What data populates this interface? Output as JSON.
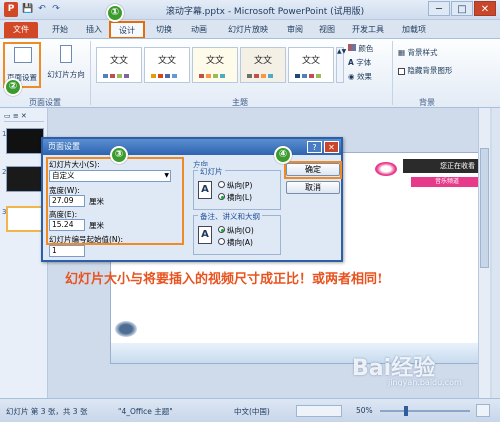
{
  "titlebar": {
    "title": "滚动字幕.pptx - Microsoft PowerPoint (试用版)",
    "logo_letter": "P",
    "qa_save": "💾",
    "qa_undo": "↶",
    "qa_redo": "↷",
    "min": "─",
    "max": "□",
    "close": "✕"
  },
  "tabs": [
    "文件",
    "开始",
    "插入",
    "设计",
    "切换",
    "动画",
    "幻灯片放映",
    "审阅",
    "视图",
    "开发工具",
    "加载项"
  ],
  "ribbon": {
    "page_setup": "页面设置",
    "orientation": "幻灯片方向",
    "group_page_setup": "页面设置",
    "group_themes": "主题",
    "group_background": "背景",
    "theme_text": "文文",
    "colors": "颜色",
    "fonts": "字体",
    "effects": "效果",
    "bg_styles": "背景样式",
    "hide_bg": "隐藏背景图形"
  },
  "slides": {
    "nums": [
      "1",
      "2",
      "3"
    ]
  },
  "dialog": {
    "title": "页面设置",
    "size_label": "幻灯片大小(S):",
    "size_value": "自定义",
    "width_label": "宽度(W):",
    "width_value": "27.09",
    "height_label": "高度(E):",
    "height_value": "15.24",
    "unit": "厘米",
    "start_label": "幻灯片编号起始值(N):",
    "start_value": "1",
    "orientation_label": "方向",
    "slides_label": "幻灯片",
    "portrait": "纵向(P)",
    "landscape": "横向(L)",
    "notes_label": "备注、讲义和大纲",
    "notes_portrait": "纵向(O)",
    "notes_landscape": "横向(A)",
    "ok": "确定",
    "cancel": "取消",
    "help": "?",
    "close": "✕"
  },
  "slide_content": {
    "watching": "您正在收看",
    "music": "音乐频道"
  },
  "caption": "幻灯片大小与将要插入的视频尺寸成正比！或两者相同!",
  "steps": [
    "①",
    "②",
    "③",
    "④"
  ],
  "status": {
    "slide_info": "幻灯片 第 3 张，共 3 张",
    "theme": "\"4_Office 主题\"",
    "lang": "中文(中国)",
    "zoom": "50%"
  },
  "watermark": "Bai经验",
  "watermark_url": "jingyan.baidu.com",
  "colors": {
    "accent_orange": "#e46c0a",
    "file_tab": "#d24726",
    "step_green": "#3c9b2f",
    "caption": "#e8531f"
  }
}
